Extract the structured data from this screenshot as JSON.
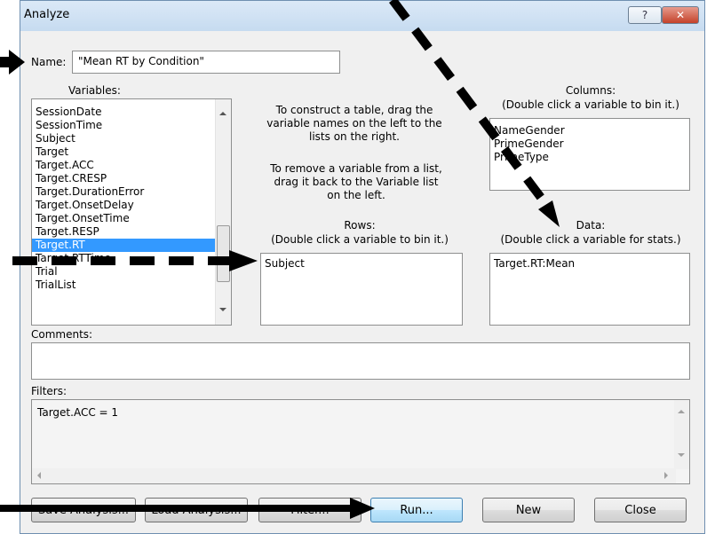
{
  "window": {
    "title": "Analyze",
    "help_label": "?",
    "close_label": "✕"
  },
  "name": {
    "label": "Name:",
    "value": "\"Mean RT by Condition\""
  },
  "variables": {
    "label": "Variables:",
    "items": [
      "SessionDate",
      "SessionTime",
      "Subject",
      "Target",
      "Target.ACC",
      "Target.CRESP",
      "Target.DurationError",
      "Target.OnsetDelay",
      "Target.OnsetTime",
      "Target.RESP",
      "Target.RT",
      "Target.RTTime",
      "Trial",
      "TrialList"
    ],
    "selected": "Target.RT"
  },
  "instructions": {
    "construct": "To construct a table, drag the variable names on the left to the lists on the right.",
    "remove": "To remove a variable from a list, drag it back to the Variable list on the left."
  },
  "columns": {
    "label": "Columns:",
    "hint": "(Double click a variable to bin it.)",
    "items": [
      "NameGender",
      "PrimeGender",
      "PrimeType"
    ]
  },
  "rows": {
    "label": "Rows:",
    "hint": "(Double click a variable to bin it.)",
    "items": [
      "Subject"
    ]
  },
  "data_list": {
    "label": "Data:",
    "hint": "(Double click a variable for stats.)",
    "items": [
      "Target.RT:Mean"
    ]
  },
  "comments": {
    "label": "Comments:",
    "value": ""
  },
  "filters": {
    "label": "Filters:",
    "value": "Target.ACC = 1"
  },
  "buttons": {
    "save": "Save Analysis...",
    "load": "Load Analysis...",
    "filter": "Filter...",
    "run": "Run...",
    "new": "New",
    "close": "Close"
  }
}
